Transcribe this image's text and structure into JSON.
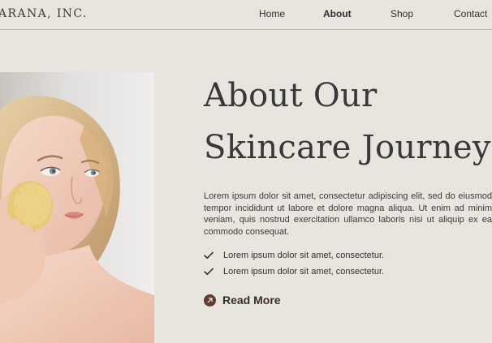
{
  "colors": {
    "page_background": "#e8e5df",
    "header_border": "#b9b2a9",
    "text_dark": "#383838",
    "accent_brown": "#5d3e30",
    "sponge_yellow": "#e8c978",
    "skin": "#f0c9b5",
    "hair": "#d8b98a",
    "image_background": "#e6e4e3"
  },
  "header": {
    "brand": "ARANA, INC.",
    "nav": [
      {
        "label": "Home",
        "active": false
      },
      {
        "label": "About",
        "active": true
      },
      {
        "label": "Shop",
        "active": false
      },
      {
        "label": "Contact",
        "active": false
      }
    ]
  },
  "hero": {
    "image_alt": "Woman holding a skincare sponge to her cheek",
    "title_line_1": "About Our",
    "title_line_2": "Skincare Journey",
    "paragraph": "Lorem ipsum dolor sit amet, consectetur adipiscing elit, sed do eiusmod tempor incididunt ut labore et dolore magna aliqua. Ut enim ad minim veniam, quis nostrud exercitation ullamco laboris nisi ut aliquip ex ea commodo consequat.",
    "list": [
      "Lorem ipsum dolor sit amet, consectetur.",
      "Lorem ipsum dolor sit amet, consectetur."
    ],
    "cta_label": "Read More",
    "icons": {
      "check": "check-icon",
      "cta": "arrow-up-right-icon"
    }
  }
}
